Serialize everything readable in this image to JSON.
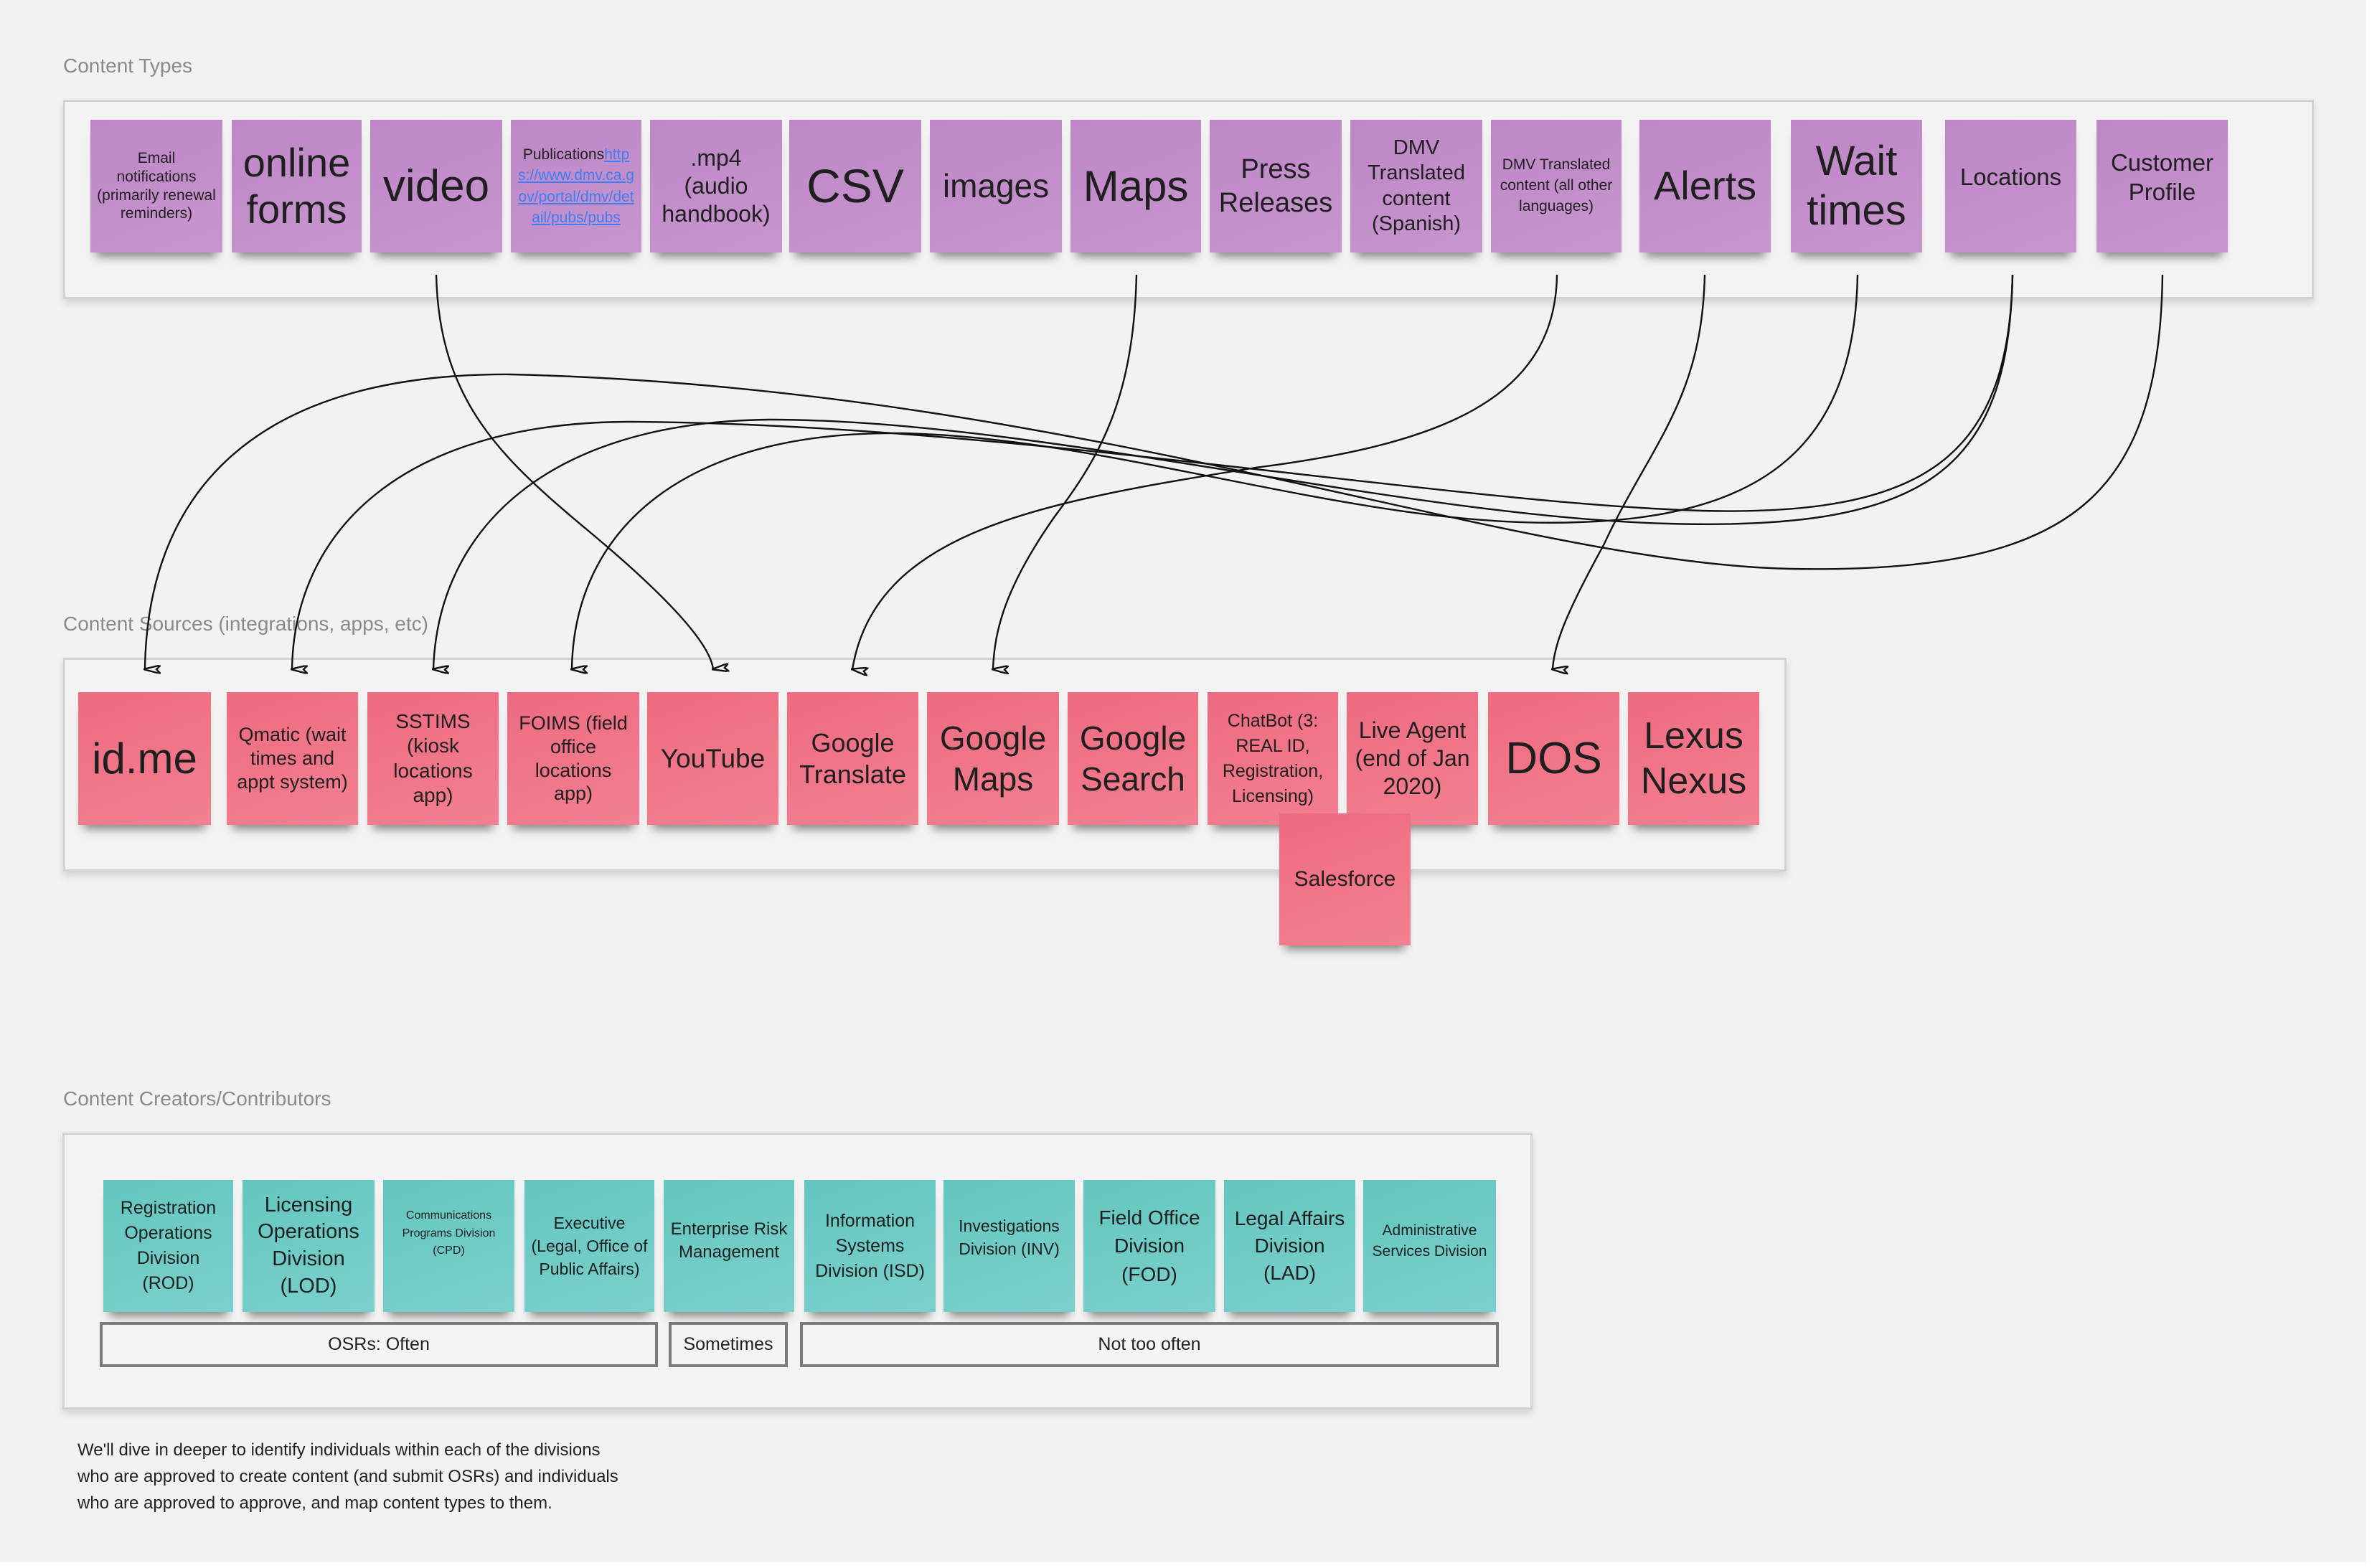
{
  "sections": {
    "content_types": {
      "label": "Content Types",
      "items": [
        {
          "id": "email",
          "text": "Email notifications (primarily renewal reminders)"
        },
        {
          "id": "online-forms",
          "text": "online forms"
        },
        {
          "id": "video",
          "text": "video"
        },
        {
          "id": "publications",
          "text": "Publications",
          "link": "https://www.dmv.ca.gov/portal/dmv/detail/pubs/pubs"
        },
        {
          "id": "mp4",
          "text": ".mp4 (audio handbook)"
        },
        {
          "id": "csv",
          "text": "CSV"
        },
        {
          "id": "images",
          "text": "images"
        },
        {
          "id": "maps",
          "text": "Maps"
        },
        {
          "id": "press-releases",
          "text": "Press Releases"
        },
        {
          "id": "dmv-spanish",
          "text": "DMV Translated content (Spanish)"
        },
        {
          "id": "dmv-other",
          "text": "DMV Translated content (all other languages)"
        },
        {
          "id": "alerts",
          "text": "Alerts"
        },
        {
          "id": "wait-times",
          "text": "Wait times"
        },
        {
          "id": "locations",
          "text": "Locations"
        },
        {
          "id": "customer-profile",
          "text": "Customer Profile"
        }
      ]
    },
    "content_sources": {
      "label": "Content Sources (integrations, apps, etc)",
      "items": [
        {
          "id": "idme",
          "text": "id.me"
        },
        {
          "id": "qmatic",
          "text": "Qmatic (wait times and appt system)"
        },
        {
          "id": "sstims",
          "text": "SSTIMS (kiosk locations app)"
        },
        {
          "id": "foims",
          "text": "FOIMS (field office locations app)"
        },
        {
          "id": "youtube",
          "text": "YouTube"
        },
        {
          "id": "google-translate",
          "text": "Google Translate"
        },
        {
          "id": "google-maps",
          "text": "Google Maps"
        },
        {
          "id": "google-search",
          "text": "Google Search"
        },
        {
          "id": "chatbot",
          "text": "ChatBot (3: REAL ID, Registration, Licensing)"
        },
        {
          "id": "live-agent",
          "text": "Live Agent (end of Jan 2020)"
        },
        {
          "id": "dos",
          "text": "DOS"
        },
        {
          "id": "lexus-nexus",
          "text": "Lexus Nexus"
        },
        {
          "id": "salesforce",
          "text": "Salesforce"
        }
      ]
    },
    "content_creators": {
      "label": "Content Creators/Contributors",
      "items": [
        {
          "id": "rod",
          "text": "Registration Operations Division (ROD)"
        },
        {
          "id": "lod",
          "text": "Licensing Operations Division (LOD)"
        },
        {
          "id": "cpd",
          "text": "Communications Programs Division (CPD)"
        },
        {
          "id": "executive",
          "text": "Executive (Legal, Office of Public Affairs)"
        },
        {
          "id": "erm",
          "text": "Enterprise Risk Management"
        },
        {
          "id": "isd",
          "text": "Information Systems Division (ISD)"
        },
        {
          "id": "inv",
          "text": "Investigations Division (INV)"
        },
        {
          "id": "fod",
          "text": "Field Office Division (FOD)"
        },
        {
          "id": "lad",
          "text": "Legal Affairs Division (LAD)"
        },
        {
          "id": "admin",
          "text": "Administrative Services Division"
        }
      ],
      "frequency_bands": [
        {
          "label": "OSRs: Often",
          "covers": [
            "rod",
            "lod",
            "cpd",
            "executive"
          ]
        },
        {
          "label": "Sometimes",
          "covers": [
            "erm"
          ]
        },
        {
          "label": "Not too often",
          "covers": [
            "isd",
            "inv",
            "fod",
            "lad",
            "admin"
          ]
        }
      ]
    }
  },
  "connections": [
    {
      "from": "video",
      "to": "youtube"
    },
    {
      "from": "maps",
      "to": "google-maps"
    },
    {
      "from": "dmv-other",
      "to": "google-translate"
    },
    {
      "from": "alerts",
      "to": "dos"
    },
    {
      "from": "wait-times",
      "to": "foims"
    },
    {
      "from": "locations",
      "to": "qmatic"
    },
    {
      "from": "locations",
      "to": "sstims"
    },
    {
      "from": "customer-profile",
      "to": "idme"
    }
  ],
  "note": {
    "lines": [
      "We'll dive in deeper to identify individuals within each of the divisions",
      "who are approved to create content (and submit OSRs) and individuals",
      "who are approved to approve, and map  content types to them."
    ]
  },
  "colors": {
    "content_type_sticky": "#c18ec9",
    "content_source_sticky": "#f07488",
    "creator_sticky": "#6fcbc5",
    "link": "#3d7ef5",
    "connector": "#111111"
  }
}
